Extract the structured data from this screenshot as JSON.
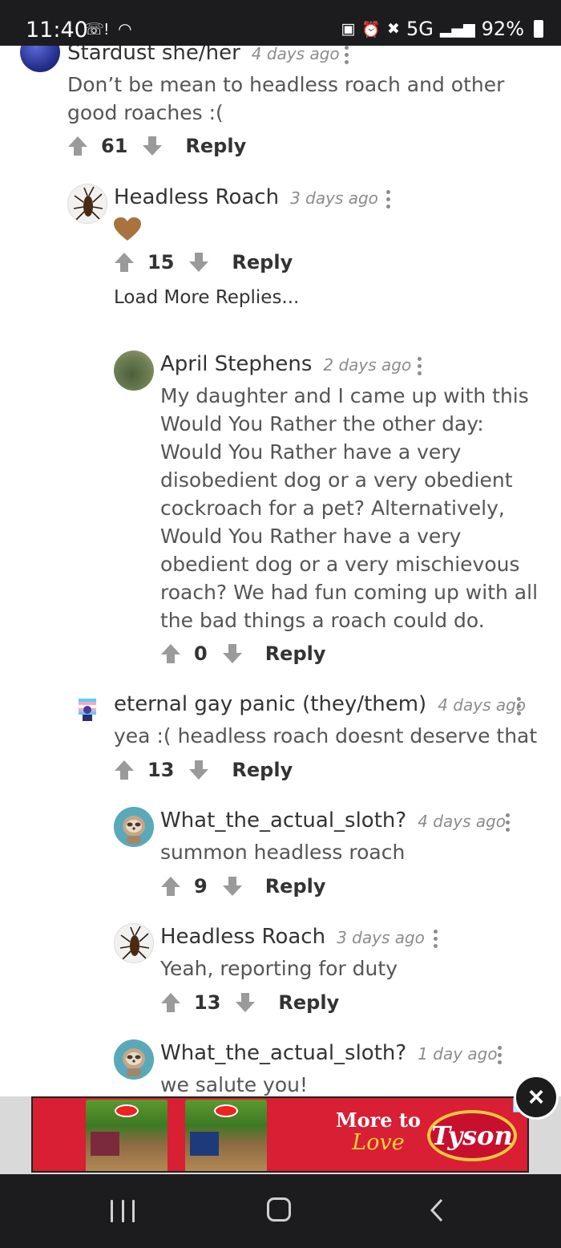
{
  "status_bar": {
    "time": "11:40",
    "left_icons": "missed-call, wifi",
    "network": "5G",
    "battery": "92%"
  },
  "comments": [
    {
      "author": "Stardust she/her",
      "time": "4 days ago",
      "body": "Don’t be mean to headless roach and other good roaches :(",
      "votes": "61",
      "reply": "Reply",
      "avatar": "blue-planet"
    },
    {
      "author": "Headless Roach",
      "time": "3 days ago",
      "body_emoji": "brown-heart",
      "votes": "15",
      "reply": "Reply",
      "avatar": "cockroach",
      "load_more": "Load More Replies..."
    },
    {
      "author": "April Stephens",
      "time": "2 days ago",
      "body": "My daughter and I came up with this Would You Rather the other day: Would You Rather have a very disobedient dog or a very obedient cockroach for a pet? Alternatively, Would You Rather have a very obedient dog or a very mischievous roach? We had fun coming up with all the bad things a roach could do.",
      "votes": "0",
      "reply": "Reply",
      "avatar": "landscape"
    },
    {
      "author": "eternal gay panic (they/them)",
      "time": "4 days ago",
      "body": "yea :( headless roach doesnt deserve that",
      "votes": "13",
      "reply": "Reply",
      "avatar": "pride-character"
    },
    {
      "author": "What_the_actual_sloth?",
      "time": "4 days ago",
      "body": "summon headless roach",
      "votes": "9",
      "reply": "Reply",
      "avatar": "sloth"
    },
    {
      "author": "Headless Roach",
      "time": "3 days ago",
      "body": "Yeah, reporting for duty",
      "votes": "13",
      "reply": "Reply",
      "avatar": "cockroach"
    },
    {
      "author": "What_the_actual_sloth?",
      "time": "1 day ago",
      "body": "we salute you!",
      "avatar": "sloth"
    }
  ],
  "ad": {
    "slogan_top": "More to",
    "slogan_bottom": "Love",
    "brand": "Tyson",
    "close": "×"
  },
  "nav": {
    "icons": [
      "recent-apps-icon",
      "home-icon",
      "back-icon"
    ]
  }
}
